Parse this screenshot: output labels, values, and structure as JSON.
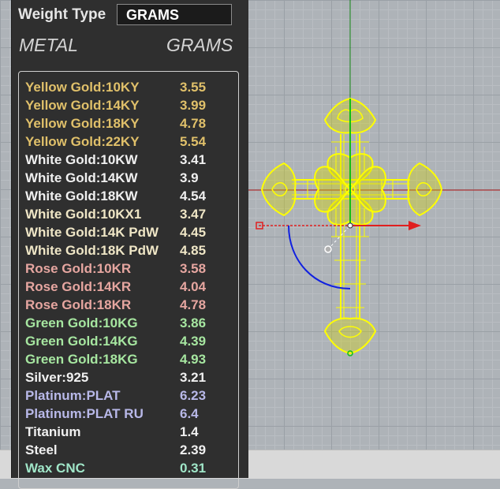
{
  "panel": {
    "weight_type_label": "Weight Type",
    "weight_type_value": "GRAMS",
    "col_metal": "METAL",
    "col_grams": "GRAMS"
  },
  "metals": [
    {
      "name": "Yellow Gold:10KY",
      "grams": "3.55",
      "color": "#e0c06a"
    },
    {
      "name": "Yellow Gold:14KY",
      "grams": "3.99",
      "color": "#e0c06a"
    },
    {
      "name": "Yellow Gold:18KY",
      "grams": "4.78",
      "color": "#e0c06a"
    },
    {
      "name": "Yellow Gold:22KY",
      "grams": "5.54",
      "color": "#e0c06a"
    },
    {
      "name": "White Gold:10KW",
      "grams": "3.41",
      "color": "#f0f0f0"
    },
    {
      "name": "White Gold:14KW",
      "grams": "3.9",
      "color": "#f0f0f0"
    },
    {
      "name": "White Gold:18KW",
      "grams": "4.54",
      "color": "#f0f0f0"
    },
    {
      "name": "White Gold:10KX1",
      "grams": "3.47",
      "color": "#efe6c6"
    },
    {
      "name": "White Gold:14K PdW",
      "grams": "4.45",
      "color": "#efe6c6"
    },
    {
      "name": "White Gold:18K PdW",
      "grams": "4.85",
      "color": "#efe6c6"
    },
    {
      "name": "Rose Gold:10KR",
      "grams": "3.58",
      "color": "#e6a6a0"
    },
    {
      "name": "Rose Gold:14KR",
      "grams": "4.04",
      "color": "#e6a6a0"
    },
    {
      "name": "Rose Gold:18KR",
      "grams": "4.78",
      "color": "#e6a6a0"
    },
    {
      "name": "Green Gold:10KG",
      "grams": "3.86",
      "color": "#a6e6a0"
    },
    {
      "name": "Green Gold:14KG",
      "grams": "4.39",
      "color": "#a6e6a0"
    },
    {
      "name": "Green Gold:18KG",
      "grams": "4.93",
      "color": "#a6e6a0"
    },
    {
      "name": "Silver:925",
      "grams": "3.21",
      "color": "#f0f0f0"
    },
    {
      "name": "Platinum:PLAT",
      "grams": "6.23",
      "color": "#b8b8e8"
    },
    {
      "name": "Platinum:PLAT RU",
      "grams": "6.4",
      "color": "#b8b8e8"
    },
    {
      "name": "Titanium",
      "grams": "1.4",
      "color": "#f0f0f0"
    },
    {
      "name": "Steel",
      "grams": "2.39",
      "color": "#f0f0f0"
    },
    {
      "name": "Wax  CNC",
      "grams": "0.31",
      "color": "#a0e6c8"
    }
  ],
  "viewport": {
    "object": "cross-pendant-wireframe",
    "object_color": "#ffff00",
    "axis_x_color": "#e02020",
    "axis_y_color": "#10c010",
    "rotation_arc_color": "#1020e0"
  }
}
